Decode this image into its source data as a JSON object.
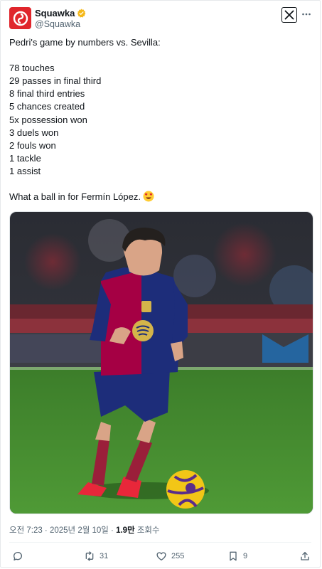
{
  "author": {
    "name": "Squawka",
    "handle": "@Squawka",
    "verified_color": "#f5b819",
    "avatar_color": "#e0262c"
  },
  "tweet": {
    "lines": [
      "Pedri's game by numbers vs. Sevilla:",
      "",
      "78 touches",
      "29 passes in final third",
      "8 final third entries",
      "5 chances created",
      "5x possession won",
      "3 duels won",
      "2 fouls won",
      "1 tackle",
      "1 assist",
      ""
    ],
    "last_line": "What a ball in for Fermín López.",
    "emoji": "heart-eyes-emoji"
  },
  "media": {
    "kit_primary": "#a50044",
    "kit_secondary": "#1d2d7a",
    "pitch_color": "#3f8a2e"
  },
  "meta": {
    "time_date": "오전 7:23 · 2025년 2월 10일 · ",
    "views_count": "1.9만",
    "views_label": " 조회수"
  },
  "actions": {
    "reply": "",
    "retweets": "31",
    "likes": "255",
    "bookmarks": "9"
  },
  "icons": [
    "squawka-logo-icon",
    "verified-badge-icon",
    "x-logo-icon",
    "more-icon",
    "reply-icon",
    "retweet-icon",
    "like-icon",
    "bookmark-icon",
    "share-icon"
  ]
}
